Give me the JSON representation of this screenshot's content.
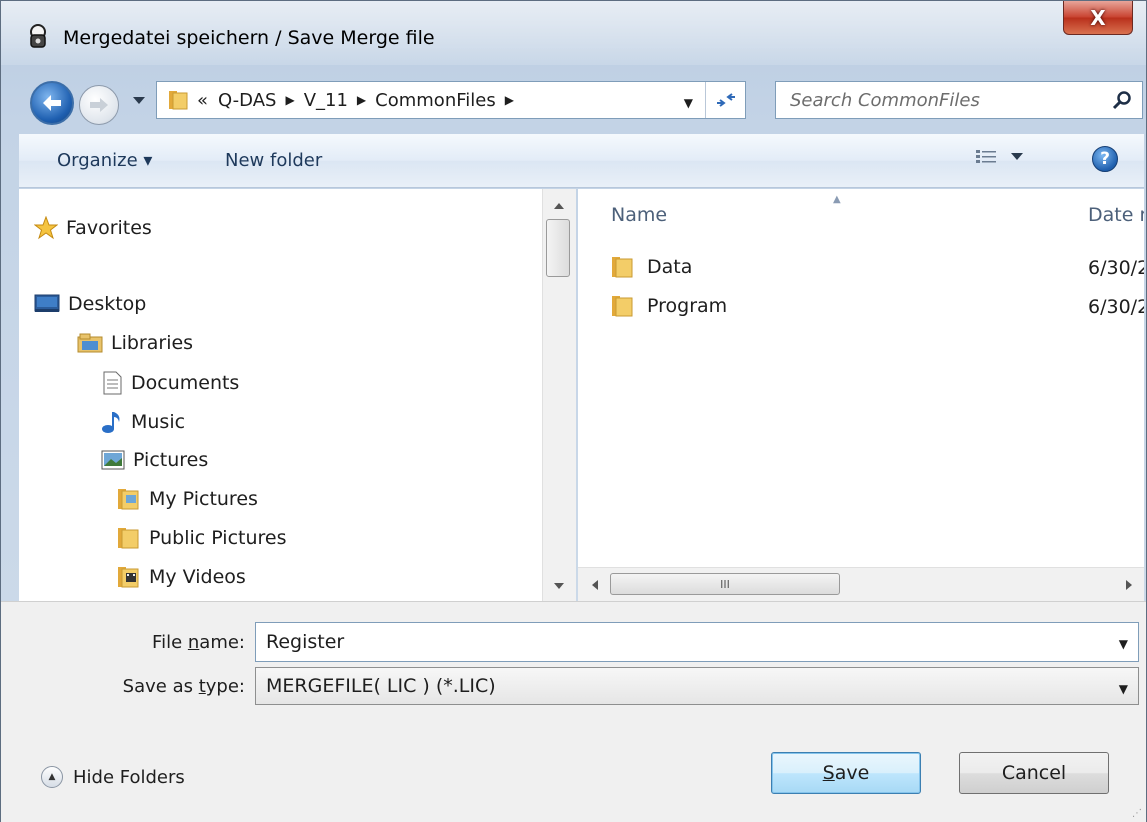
{
  "window": {
    "title": "Mergedatei speichern / Save Merge file",
    "close_label": "X"
  },
  "navbar": {
    "breadcrumb_prefix": "«",
    "breadcrumbs": [
      "Q-DAS",
      "V_11",
      "CommonFiles"
    ],
    "search_placeholder": "Search CommonFiles"
  },
  "toolbar": {
    "organize_label": "Organize ▾",
    "new_folder_label": "New folder",
    "help_label": "?"
  },
  "nav_pane": {
    "items": [
      {
        "label": "Favorites",
        "icon": "star-icon"
      },
      {
        "label": "Desktop",
        "icon": "desktop-icon"
      },
      {
        "label": "Libraries",
        "icon": "libraries-icon"
      },
      {
        "label": "Documents",
        "icon": "document-icon"
      },
      {
        "label": "Music",
        "icon": "music-icon"
      },
      {
        "label": "Pictures",
        "icon": "pictures-icon"
      },
      {
        "label": "My Pictures",
        "icon": "folder-icon"
      },
      {
        "label": "Public Pictures",
        "icon": "folder-icon"
      },
      {
        "label": "My Videos",
        "icon": "video-folder-icon"
      }
    ]
  },
  "file_pane": {
    "columns": {
      "name": "Name",
      "date": "Date r"
    },
    "rows": [
      {
        "name": "Data",
        "date": "6/30/2"
      },
      {
        "name": "Program",
        "date": "6/30/2"
      }
    ],
    "hscroll_label": "III"
  },
  "bottom": {
    "file_name_label_pre": "File ",
    "file_name_label_u": "n",
    "file_name_label_post": "ame:",
    "file_name_value": "Register",
    "save_type_label_pre": "Save as ",
    "save_type_label_u": "t",
    "save_type_label_post": "ype:",
    "save_type_value": "MERGEFILE( LIC ) (*.LIC)",
    "hide_folders_label": "Hide Folders",
    "save_label_u": "S",
    "save_label_post": "ave",
    "cancel_label": "Cancel"
  },
  "colors": {
    "accent": "#2f6ab8",
    "close": "#c94532",
    "folder": "#e8b94a"
  }
}
